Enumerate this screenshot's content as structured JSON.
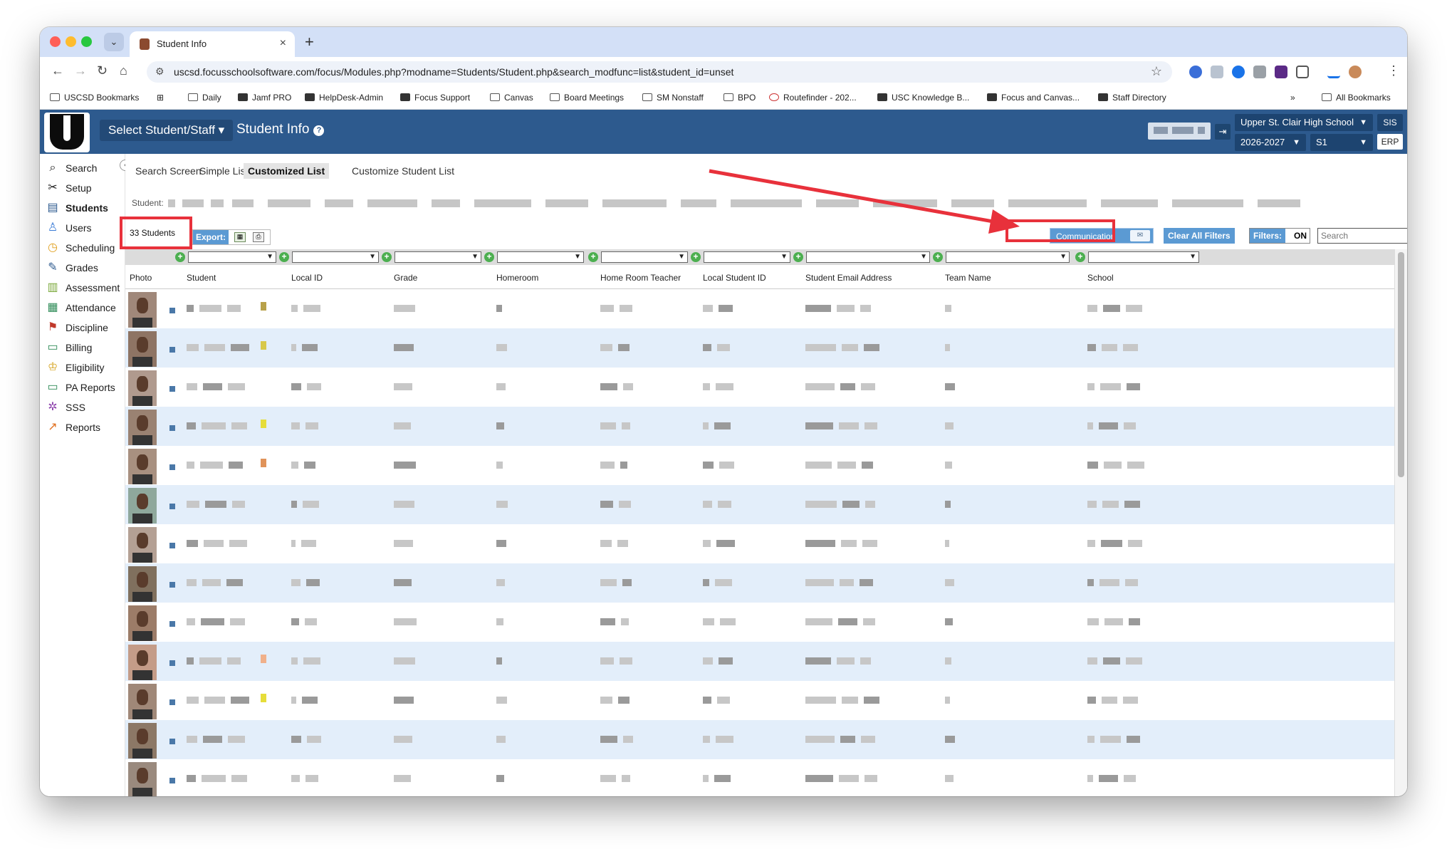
{
  "browser": {
    "tab_title": "Student Info",
    "url": "uscsd.focusschoolsoftware.com/focus/Modules.php?modname=Students/Student.php&search_modfunc=list&student_id=unset",
    "bookmarks": [
      "USCSD Bookmarks",
      "Daily",
      "Jamf PRO",
      "HelpDesk-Admin",
      "Focus Support",
      "Canvas",
      "Board Meetings",
      "SM Nonstaff",
      "BPO",
      "Routefinder - 202...",
      "USC Knowledge B...",
      "Focus and Canvas...",
      "Staff Directory"
    ],
    "all_bookmarks": "All Bookmarks",
    "overflow": "»"
  },
  "header": {
    "select_student": "Select Student/Staff ▾",
    "title": "Student Info",
    "school": "Upper St. Clair High School",
    "year": "2026-2027",
    "term": "S1",
    "sis": "SIS",
    "erp": "ERP"
  },
  "sidebar": {
    "items": [
      {
        "label": "Search",
        "icon": "search-icon"
      },
      {
        "label": "Setup",
        "icon": "tools-icon"
      },
      {
        "label": "Students",
        "icon": "students-icon"
      },
      {
        "label": "Users",
        "icon": "users-icon"
      },
      {
        "label": "Scheduling",
        "icon": "clock-icon"
      },
      {
        "label": "Grades",
        "icon": "grades-icon"
      },
      {
        "label": "Assessment",
        "icon": "chart-icon"
      },
      {
        "label": "Attendance",
        "icon": "calendar-icon"
      },
      {
        "label": "Discipline",
        "icon": "discipline-icon"
      },
      {
        "label": "Billing",
        "icon": "billing-icon"
      },
      {
        "label": "Eligibility",
        "icon": "trophy-icon"
      },
      {
        "label": "PA Reports",
        "icon": "pa-reports-icon"
      },
      {
        "label": "SSS",
        "icon": "sss-icon"
      },
      {
        "label": "Reports",
        "icon": "reports-icon"
      }
    ]
  },
  "main": {
    "tabs": [
      "Search Screen",
      "Simple List",
      "Customized List",
      "Customize Student List"
    ],
    "student_label": "Student:",
    "count": "33 Students",
    "export_label": "Export:",
    "communication": "Communication",
    "clear_filters": "Clear All Filters",
    "filters_label": "Filters:",
    "filters_state": "ON",
    "search_placeholder": "Search",
    "columns": [
      "Photo",
      "Student",
      "Local ID",
      "Grade",
      "Homeroom",
      "Home Room Teacher",
      "Local Student ID",
      "Student Email Address",
      "Team Name",
      "School"
    ]
  },
  "colors": {
    "header_blue": "#2d5a8e",
    "button_blue": "#5b9ad3",
    "highlight_red": "#e8313b",
    "row_alt": "#e3eefa"
  }
}
